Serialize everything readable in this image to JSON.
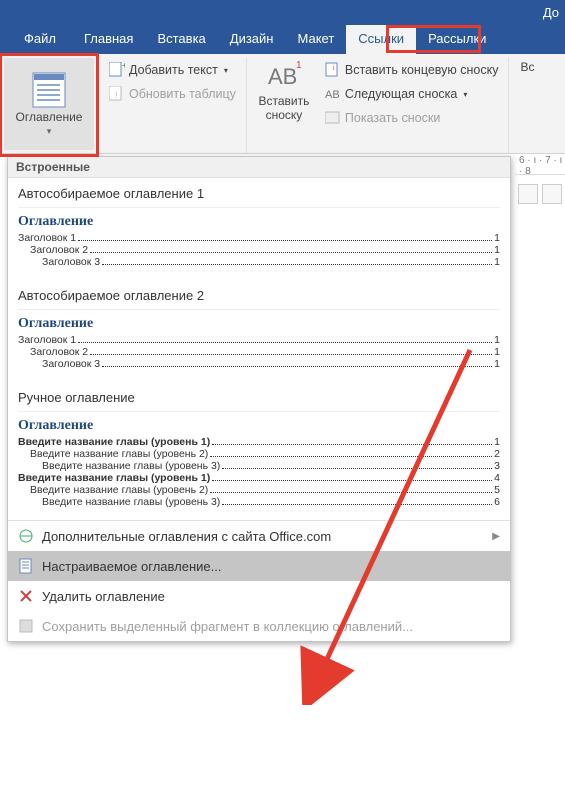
{
  "titlebar": {
    "doc_hint": "До"
  },
  "tabs": {
    "file": "Файл",
    "home": "Главная",
    "insert": "Вставка",
    "design": "Дизайн",
    "layout": "Макет",
    "references": "Ссылки",
    "mailings": "Рассылки"
  },
  "ribbon": {
    "toc": {
      "label": "Оглавление"
    },
    "add_text": "Добавить текст",
    "update_table": "Обновить таблицу",
    "insert_footnote_line1": "Вставить",
    "insert_footnote_line2": "сноску",
    "insert_endnote": "Вставить концевую сноску",
    "next_footnote": "Следующая сноска",
    "show_notes": "Показать сноски",
    "insert_right": "Вс"
  },
  "dropdown": {
    "section_builtin": "Встроенные",
    "auto1": {
      "name": "Автособираемое оглавление 1",
      "title": "Оглавление",
      "rows": [
        {
          "text": "Заголовок 1",
          "page": "1",
          "lvl": 1
        },
        {
          "text": "Заголовок 2",
          "page": "1",
          "lvl": 2
        },
        {
          "text": "Заголовок 3",
          "page": "1",
          "lvl": 3
        }
      ]
    },
    "auto2": {
      "name": "Автособираемое оглавление 2",
      "title": "Оглавление",
      "rows": [
        {
          "text": "Заголовок 1",
          "page": "1",
          "lvl": 1
        },
        {
          "text": "Заголовок 2",
          "page": "1",
          "lvl": 2
        },
        {
          "text": "Заголовок 3",
          "page": "1",
          "lvl": 3
        }
      ]
    },
    "manual": {
      "name": "Ручное оглавление",
      "title": "Оглавление",
      "rows": [
        {
          "text": "Введите название главы (уровень 1)",
          "page": "1",
          "lvl": 1,
          "bold": true
        },
        {
          "text": "Введите название главы (уровень 2)",
          "page": "2",
          "lvl": 2
        },
        {
          "text": "Введите название главы (уровень 3)",
          "page": "3",
          "lvl": 3
        },
        {
          "text": "Введите название главы (уровень 1)",
          "page": "4",
          "lvl": 1,
          "bold": true
        },
        {
          "text": "Введите название главы (уровень 2)",
          "page": "5",
          "lvl": 2
        },
        {
          "text": "Введите название главы (уровень 3)",
          "page": "6",
          "lvl": 3
        }
      ]
    },
    "more_office": "Дополнительные оглавления с сайта Office.com",
    "custom_toc": "Настраиваемое оглавление...",
    "remove_toc": "Удалить оглавление",
    "save_selection": "Сохранить выделенный фрагмент в коллекцию оглавлений..."
  },
  "ruler": {
    "marks": "6 · ı · 7 · ı · 8"
  }
}
